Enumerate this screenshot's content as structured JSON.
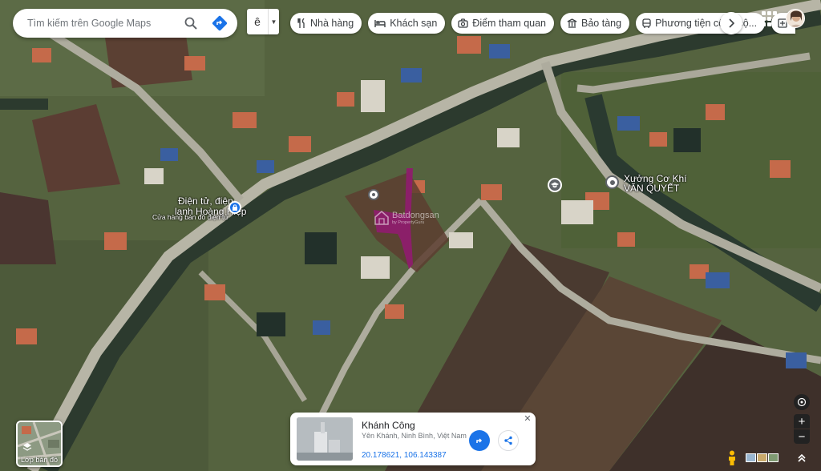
{
  "search": {
    "placeholder": "Tìm kiếm trên Google Maps"
  },
  "language": {
    "value": "ê"
  },
  "chips": [
    {
      "label": "Nhà hàng",
      "icon": "fork-knife-icon"
    },
    {
      "label": "Khách sạn",
      "icon": "bed-icon"
    },
    {
      "label": "Điểm tham quan",
      "icon": "camera-icon"
    },
    {
      "label": "Bảo tàng",
      "icon": "museum-icon"
    },
    {
      "label": "Phương tiện công cộ...",
      "icon": "bus-icon"
    }
  ],
  "map_labels": {
    "shop_name_line1": "Điện tử, điện",
    "shop_name_line2": "lạnh Hoàng Hiệp",
    "shop_category": "Cửa hàng bán đồ điện tử",
    "workshop_line1": "Xưởng Cơ Khí",
    "workshop_line2": "VĂN QUYẾT",
    "watermark_main": "Batdongsan",
    "watermark_sub": "by PropertyGuru"
  },
  "layer_button": {
    "label": "Lớp bản đồ"
  },
  "info_card": {
    "title": "Khánh Công",
    "subtitle": "Yên Khánh, Ninh Bình, Việt Nam",
    "coordinates": "20.178621, 106.143387",
    "close_symbol": "✕"
  },
  "controls": {
    "zoom_in": "+",
    "zoom_out": "−"
  },
  "colors": {
    "accent": "#1a73e8",
    "highlight_parcel": "#8e1d6d"
  }
}
